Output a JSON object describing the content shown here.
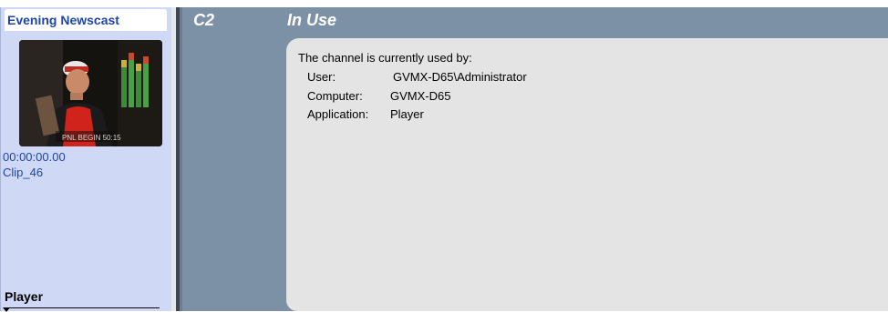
{
  "channel_panel": {
    "title": "Evening Newscast",
    "thumbnail_overlay_text": "PNL BEGIN 50:15",
    "timecode": "00:00:00.00",
    "clip_name": "Clip_46",
    "mode_label": "Player"
  },
  "status_panel": {
    "channel_id": "C2",
    "status_title": "In Use",
    "message": {
      "heading": "The channel is currently used by:",
      "user_label": "User:",
      "user_value": "GVMX-D65\\Administrator",
      "computer_label": "Computer:",
      "computer_value": "GVMX-D65",
      "application_label": "Application:",
      "application_value": "Player"
    }
  },
  "colors": {
    "left_panel_bg": "#cfd9f6",
    "left_text": "#1f45a8",
    "right_panel_bg": "#7d91a6",
    "message_box_bg": "#e4e4e4"
  },
  "icons": {
    "mode_dropdown": "triangle-down-icon"
  }
}
